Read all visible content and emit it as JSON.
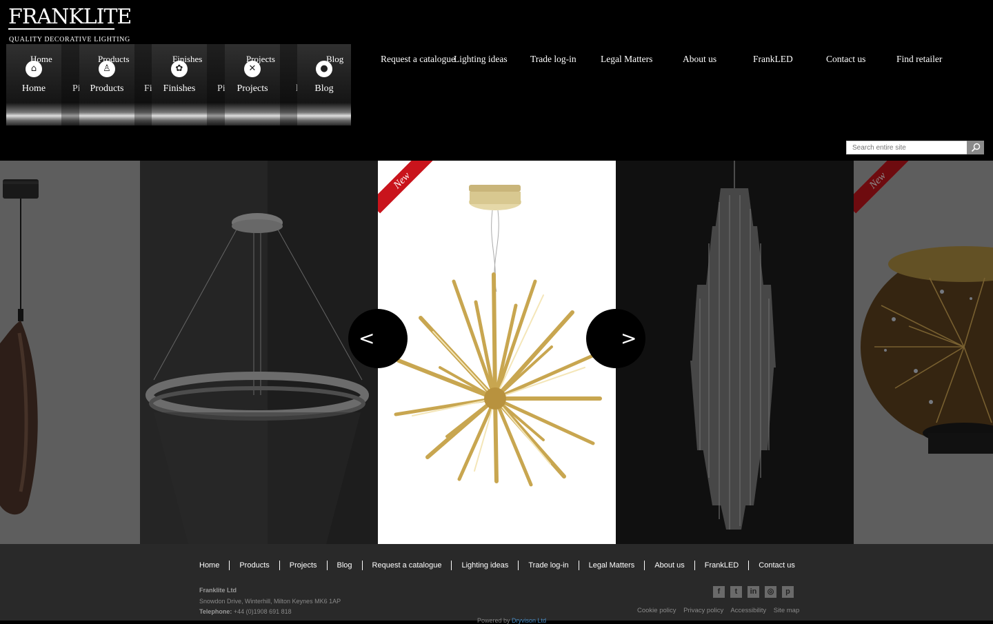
{
  "logo": {
    "brand": "FRANKLITE",
    "tagline": "QUALITY DECORATIVE LIGHTING"
  },
  "main_nav": [
    {
      "top": "Home",
      "label": "Home",
      "icon": "home-icon"
    },
    {
      "top": "Products",
      "label": "Products",
      "icon": "lamp-icon"
    },
    {
      "top": "Finishes",
      "label": "Finishes",
      "icon": "palette-icon"
    },
    {
      "top": "Projects",
      "label": "Projects",
      "icon": "tools-icon"
    },
    {
      "top": "Blog",
      "label": "Blog",
      "icon": "speech-bubble-icon"
    }
  ],
  "ghost_labels": {
    "products": "Pi",
    "finishes": "Fi",
    "projects": "Pi",
    "blog": "l"
  },
  "top_nav": [
    "Request a catalogue",
    "Lighting ideas",
    "Trade log-in",
    "Legal Matters",
    "About us",
    "FrankLED",
    "Contact us",
    "Find retailer"
  ],
  "search": {
    "placeholder": "Search entire site",
    "icon": "search-icon"
  },
  "carousel": {
    "ribbon": "New",
    "prev": "<",
    "next": ">",
    "slides": [
      "copper-pendant",
      "ring-pendant",
      "gold-starburst-pendant",
      "crystal-chandelier",
      "firework-table-lamp"
    ]
  },
  "footer": {
    "nav": [
      "Home",
      "Products",
      "Projects",
      "Blog",
      "Request a catalogue",
      "Lighting ideas",
      "Trade log-in",
      "Legal Matters",
      "About us",
      "FrankLED",
      "Contact us"
    ],
    "company": "Franklite Ltd",
    "address": "Snowdon Drive, Winterhill, Milton Keynes MK6 1AP",
    "telephone_label": "Telephone:",
    "telephone": "+44 (0)1908 691 818",
    "social": [
      "facebook-icon",
      "twitter-icon",
      "linkedin-icon",
      "instagram-icon",
      "pinterest-icon"
    ],
    "legal": [
      "Cookie policy",
      "Privacy policy",
      "Accessibility",
      "Site map"
    ],
    "powered_prefix": "Powered by",
    "powered_link": "Dryvison Ltd"
  },
  "colors": {
    "ribbon": "#c9141c",
    "footer_bg": "#292929",
    "page_bg": "#000000"
  }
}
